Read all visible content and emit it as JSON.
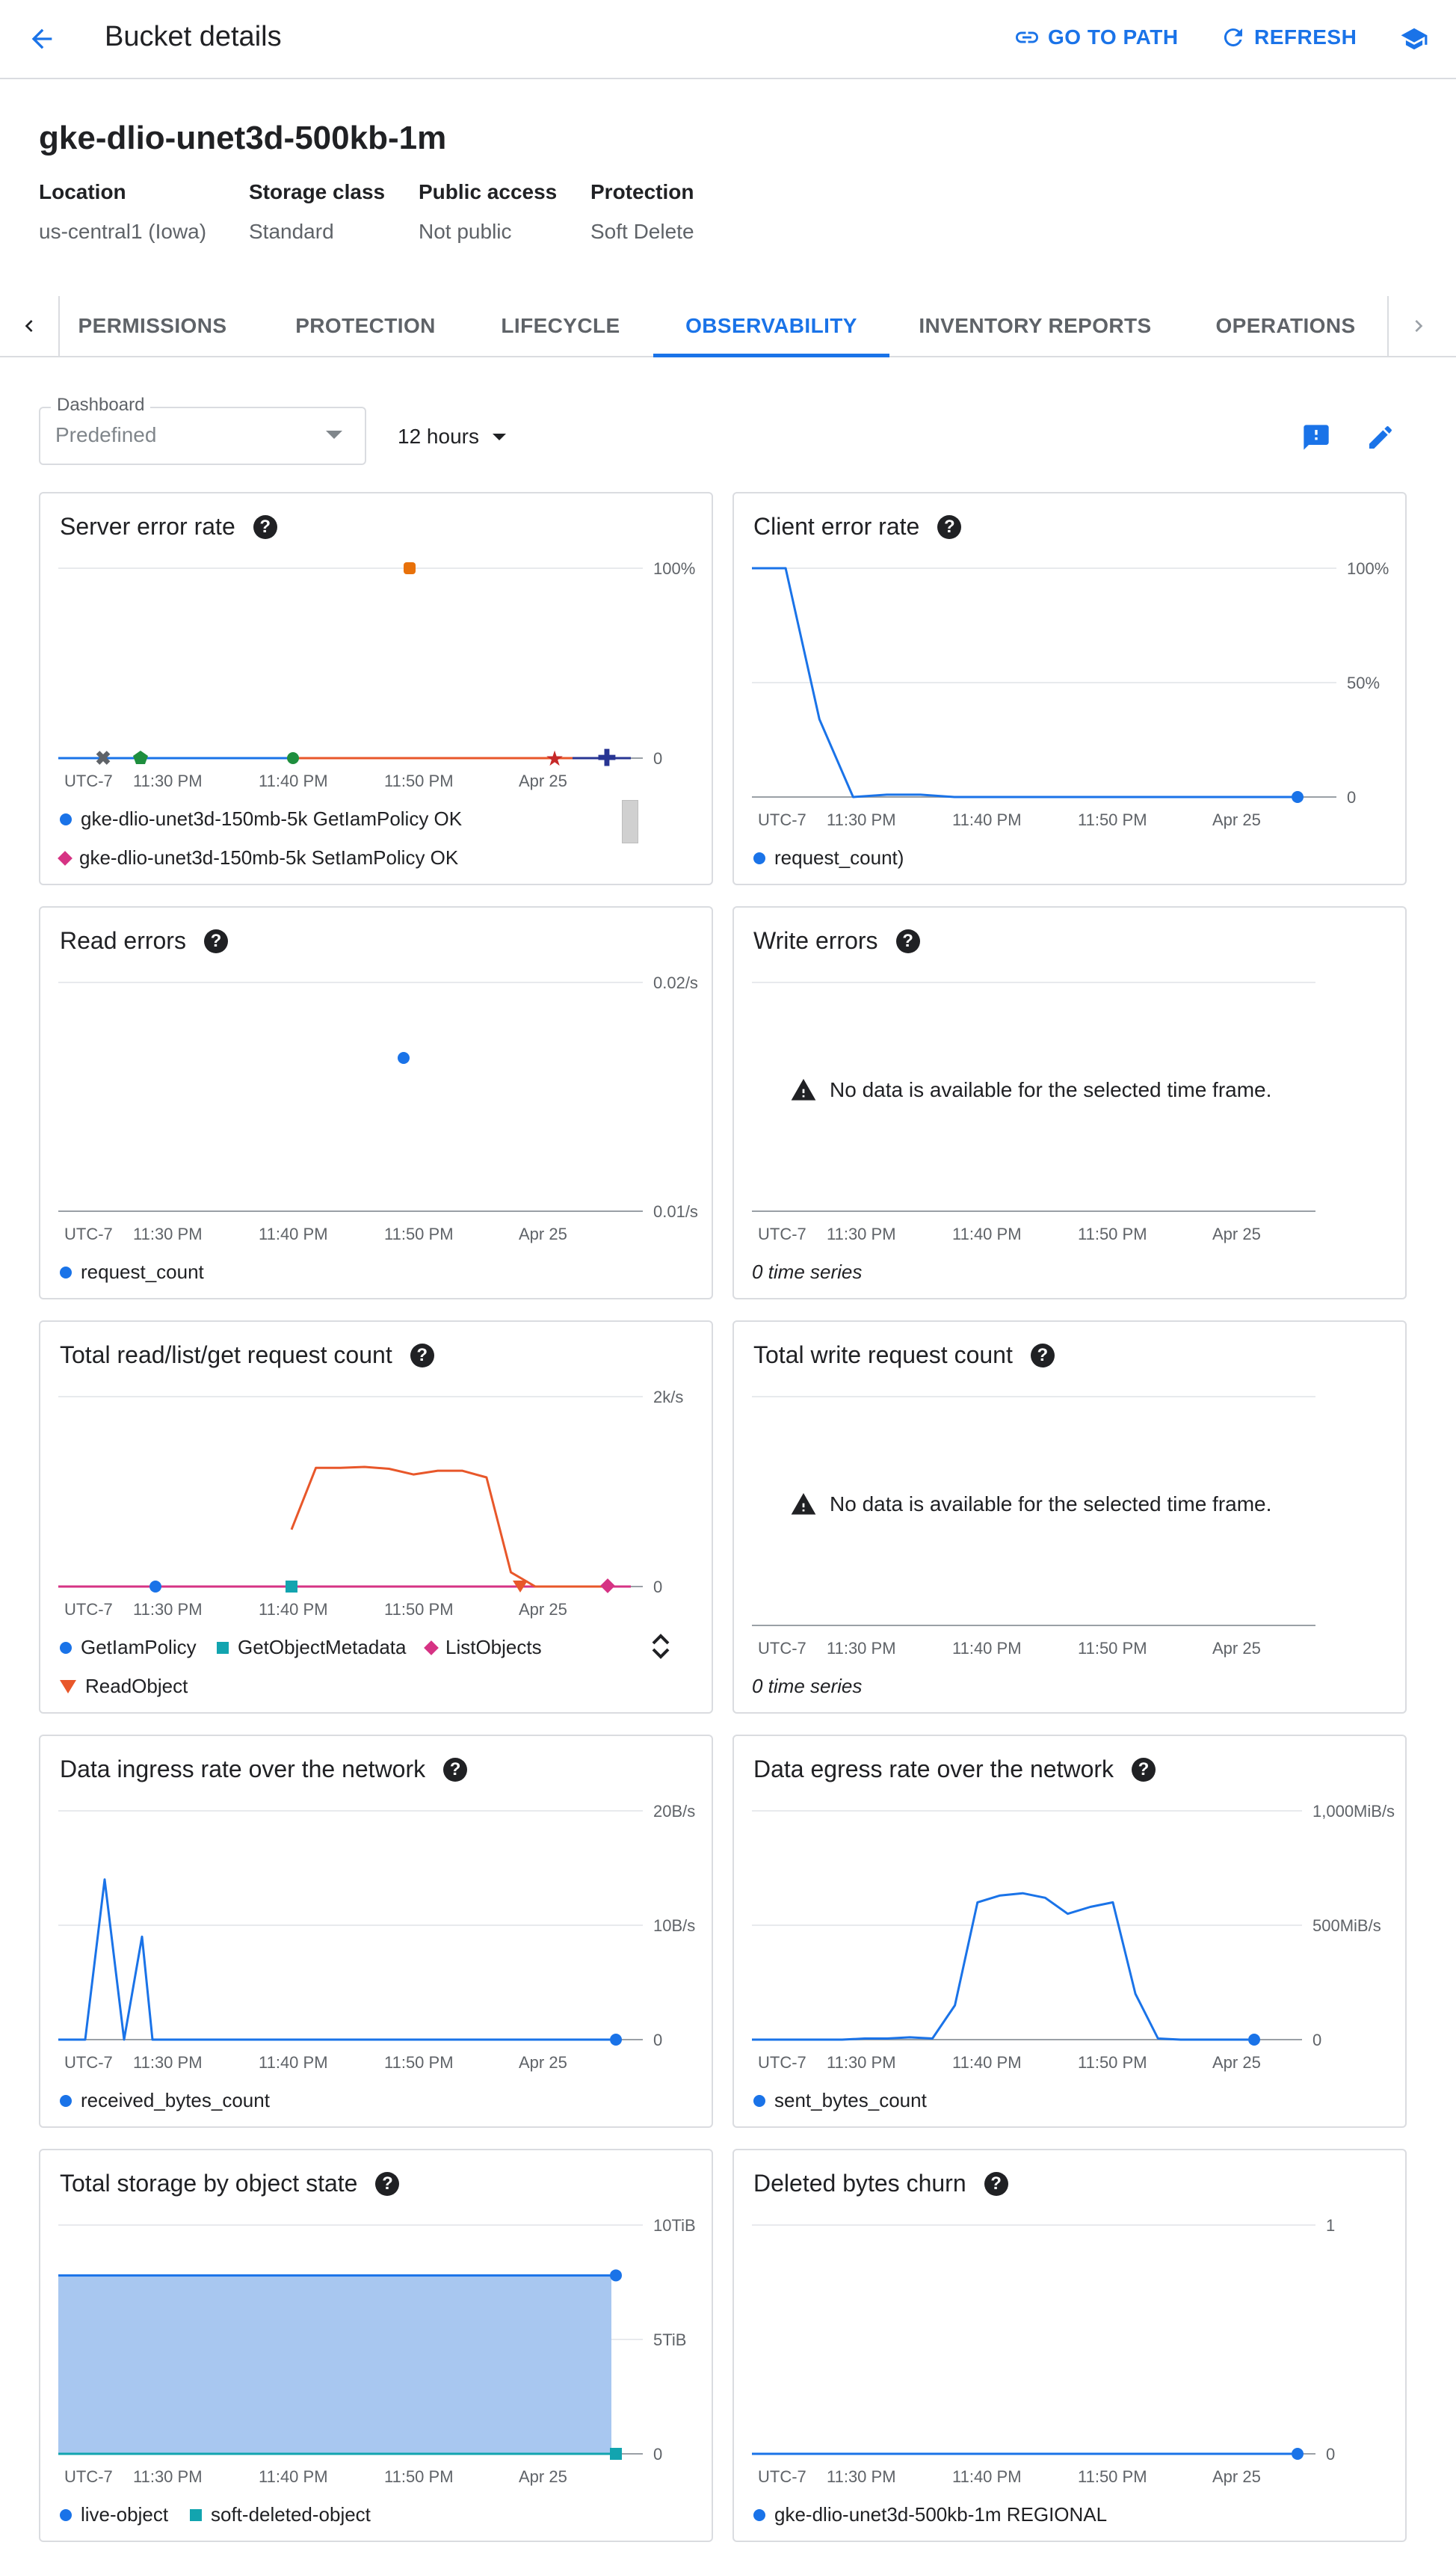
{
  "header": {
    "title": "Bucket details",
    "go_to_path": "GO TO PATH",
    "refresh": "REFRESH"
  },
  "bucket": {
    "name": "gke-dlio-unet3d-500kb-1m",
    "meta": [
      {
        "label": "Location",
        "value": "us-central1 (Iowa)"
      },
      {
        "label": "Storage class",
        "value": "Standard"
      },
      {
        "label": "Public access",
        "value": "Not public"
      },
      {
        "label": "Protection",
        "value": "Soft Delete"
      }
    ]
  },
  "tabs": [
    "PERMISSIONS",
    "PROTECTION",
    "LIFECYCLE",
    "OBSERVABILITY",
    "INVENTORY REPORTS",
    "OPERATIONS"
  ],
  "active_tab": "OBSERVABILITY",
  "toolbar": {
    "dashboard_label": "Dashboard",
    "dashboard_value": "Predefined",
    "time_range": "12 hours"
  },
  "x_ticks": [
    "UTC-7",
    "11:30 PM",
    "11:40 PM",
    "11:50 PM",
    "Apr 25"
  ],
  "no_data_message": "No data is available for the selected time frame.",
  "zero_series": "0 time series",
  "colors": {
    "accent": "#1a73e8",
    "blue": "#1a73e8",
    "red": "#e8572a",
    "pink": "#d63384",
    "teal": "#12a4af",
    "green": "#1e8e3e",
    "orange": "#e8710a",
    "navy": "#283593",
    "area": "#a8c7f0"
  },
  "chart_data": [
    {
      "id": "server-error-rate",
      "type": "scatter",
      "title": "Server error rate",
      "y_ticks": [
        "100%",
        "0"
      ],
      "ylim": [
        0,
        100
      ],
      "series": [
        {
          "name": "gke-dlio-unet3d-150mb-5k GetIamPolicy OK",
          "color": "#1a73e8",
          "values": [
            0,
            0,
            0,
            0,
            0
          ]
        },
        {
          "name": "gke-dlio-unet3d-150mb-5k SetIamPolicy OK",
          "color": "#d63384",
          "values": [
            0,
            0,
            0,
            0,
            0
          ]
        }
      ],
      "extra_marks": [
        {
          "label": "orange-error-point",
          "color": "#e8710a",
          "y": 100
        }
      ]
    },
    {
      "id": "client-error-rate",
      "type": "line",
      "title": "Client error rate",
      "y_ticks": [
        "100%",
        "50%",
        "0"
      ],
      "ylim": [
        0,
        100
      ],
      "series": [
        {
          "name": "request_count)",
          "color": "#1a73e8",
          "values": [
            100,
            100,
            34,
            0,
            1,
            1,
            0,
            0,
            0,
            0,
            0,
            0,
            0,
            0,
            0,
            0,
            0
          ]
        }
      ]
    },
    {
      "id": "read-errors",
      "type": "scatter",
      "title": "Read errors",
      "y_ticks": [
        "0.02/s",
        "0.01/s"
      ],
      "ylim": [
        0.01,
        0.02
      ],
      "series": [
        {
          "name": "request_count",
          "color": "#1a73e8",
          "points": [
            {
              "x": "11:49 PM",
              "y": 0.0167
            }
          ]
        }
      ]
    },
    {
      "id": "write-errors",
      "type": "line",
      "title": "Write errors",
      "series": []
    },
    {
      "id": "total-read-request-count",
      "type": "line",
      "title": "Total read/list/get request count",
      "y_ticks": [
        "2k/s",
        "0"
      ],
      "ylim": [
        0,
        2000
      ],
      "series": [
        {
          "name": "GetIamPolicy",
          "color": "#1a73e8",
          "values": [
            0,
            0,
            0,
            0
          ]
        },
        {
          "name": "GetObjectMetadata",
          "color": "#12a4af",
          "values": [
            0,
            0,
            0,
            0
          ]
        },
        {
          "name": "ListObjects",
          "color": "#d63384",
          "values": [
            0,
            0,
            0,
            0
          ]
        },
        {
          "name": "ReadObject",
          "color": "#e8572a",
          "values": [
            600,
            1250,
            1250,
            1260,
            1240,
            1180,
            1220,
            1220,
            1150,
            150,
            0,
            0,
            0,
            0
          ]
        }
      ]
    },
    {
      "id": "total-write-request-count",
      "type": "line",
      "title": "Total write request count",
      "series": []
    },
    {
      "id": "data-ingress-rate",
      "type": "line",
      "title": "Data ingress rate over the network",
      "y_ticks": [
        "20B/s",
        "10B/s",
        "0"
      ],
      "ylim": [
        0,
        20
      ],
      "series": [
        {
          "name": "received_bytes_count",
          "color": "#1a73e8",
          "values": [
            0,
            0,
            14,
            0,
            9,
            0,
            0,
            0,
            0,
            0,
            0,
            0,
            0,
            0,
            0,
            0
          ]
        }
      ]
    },
    {
      "id": "data-egress-rate",
      "type": "line",
      "title": "Data egress rate over the network",
      "y_ticks": [
        "1,000MiB/s",
        "500MiB/s",
        "0"
      ],
      "ylim": [
        0,
        1000
      ],
      "series": [
        {
          "name": "sent_bytes_count",
          "color": "#1a73e8",
          "values": [
            0,
            0,
            0,
            0,
            0,
            5,
            5,
            10,
            5,
            150,
            600,
            630,
            640,
            620,
            550,
            580,
            600,
            200,
            5,
            0,
            0,
            0,
            0
          ]
        }
      ]
    },
    {
      "id": "total-storage",
      "type": "area",
      "title": "Total storage by object state",
      "y_ticks": [
        "10TiB",
        "5TiB",
        "0"
      ],
      "ylim": [
        0,
        10
      ],
      "series": [
        {
          "name": "live-object",
          "color": "#1a73e8",
          "values": [
            7.8,
            7.8
          ]
        },
        {
          "name": "soft-deleted-object",
          "color": "#12a4af",
          "values": [
            0,
            0
          ]
        }
      ]
    },
    {
      "id": "deleted-bytes-churn",
      "type": "line",
      "title": "Deleted bytes churn",
      "y_ticks": [
        "1",
        "0"
      ],
      "ylim": [
        0,
        1
      ],
      "series": [
        {
          "name": "gke-dlio-unet3d-500kb-1m REGIONAL",
          "color": "#1a73e8",
          "values": [
            0,
            0
          ]
        }
      ]
    }
  ]
}
